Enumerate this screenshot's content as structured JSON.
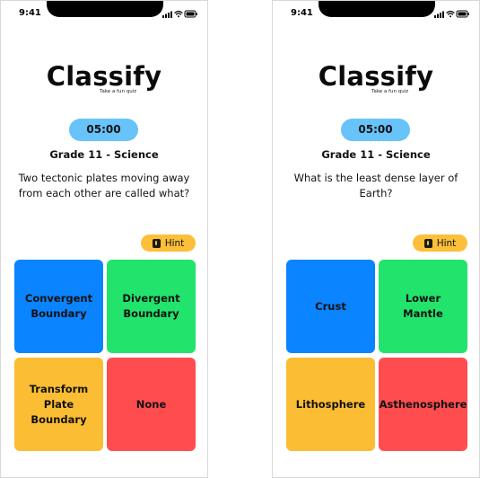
{
  "screens": [
    {
      "status_time": "9:41",
      "logo": "Classify",
      "tagline": "Take a fun quiz",
      "timer": "05:00",
      "grade": "Grade 11 - Science",
      "question": "Two tectonic plates moving away from each other are called what?",
      "hint_label": "Hint",
      "hint_icon": "lightbulb-icon",
      "answers": [
        {
          "label": "Convergent Boundary",
          "color": "#0a84ff"
        },
        {
          "label": "Divergent Boundary",
          "color": "#22e36c"
        },
        {
          "label": "Transform Plate Boundary",
          "color": "#fbbd33"
        },
        {
          "label": "None",
          "color": "#ff4d4f"
        }
      ]
    },
    {
      "status_time": "9:41",
      "logo": "Classify",
      "tagline": "Take a fun quiz",
      "timer": "05:00",
      "grade": "Grade 11 - Science",
      "question": "What is the least dense layer of Earth?",
      "hint_label": "Hint",
      "hint_icon": "lightbulb-icon",
      "answers": [
        {
          "label": "Crust",
          "color": "#0a84ff"
        },
        {
          "label": "Lower Mantle",
          "color": "#22e36c"
        },
        {
          "label": "Lithosphere",
          "color": "#fbbd33"
        },
        {
          "label": "Asthenosphere",
          "color": "#ff4d4f"
        }
      ]
    }
  ]
}
